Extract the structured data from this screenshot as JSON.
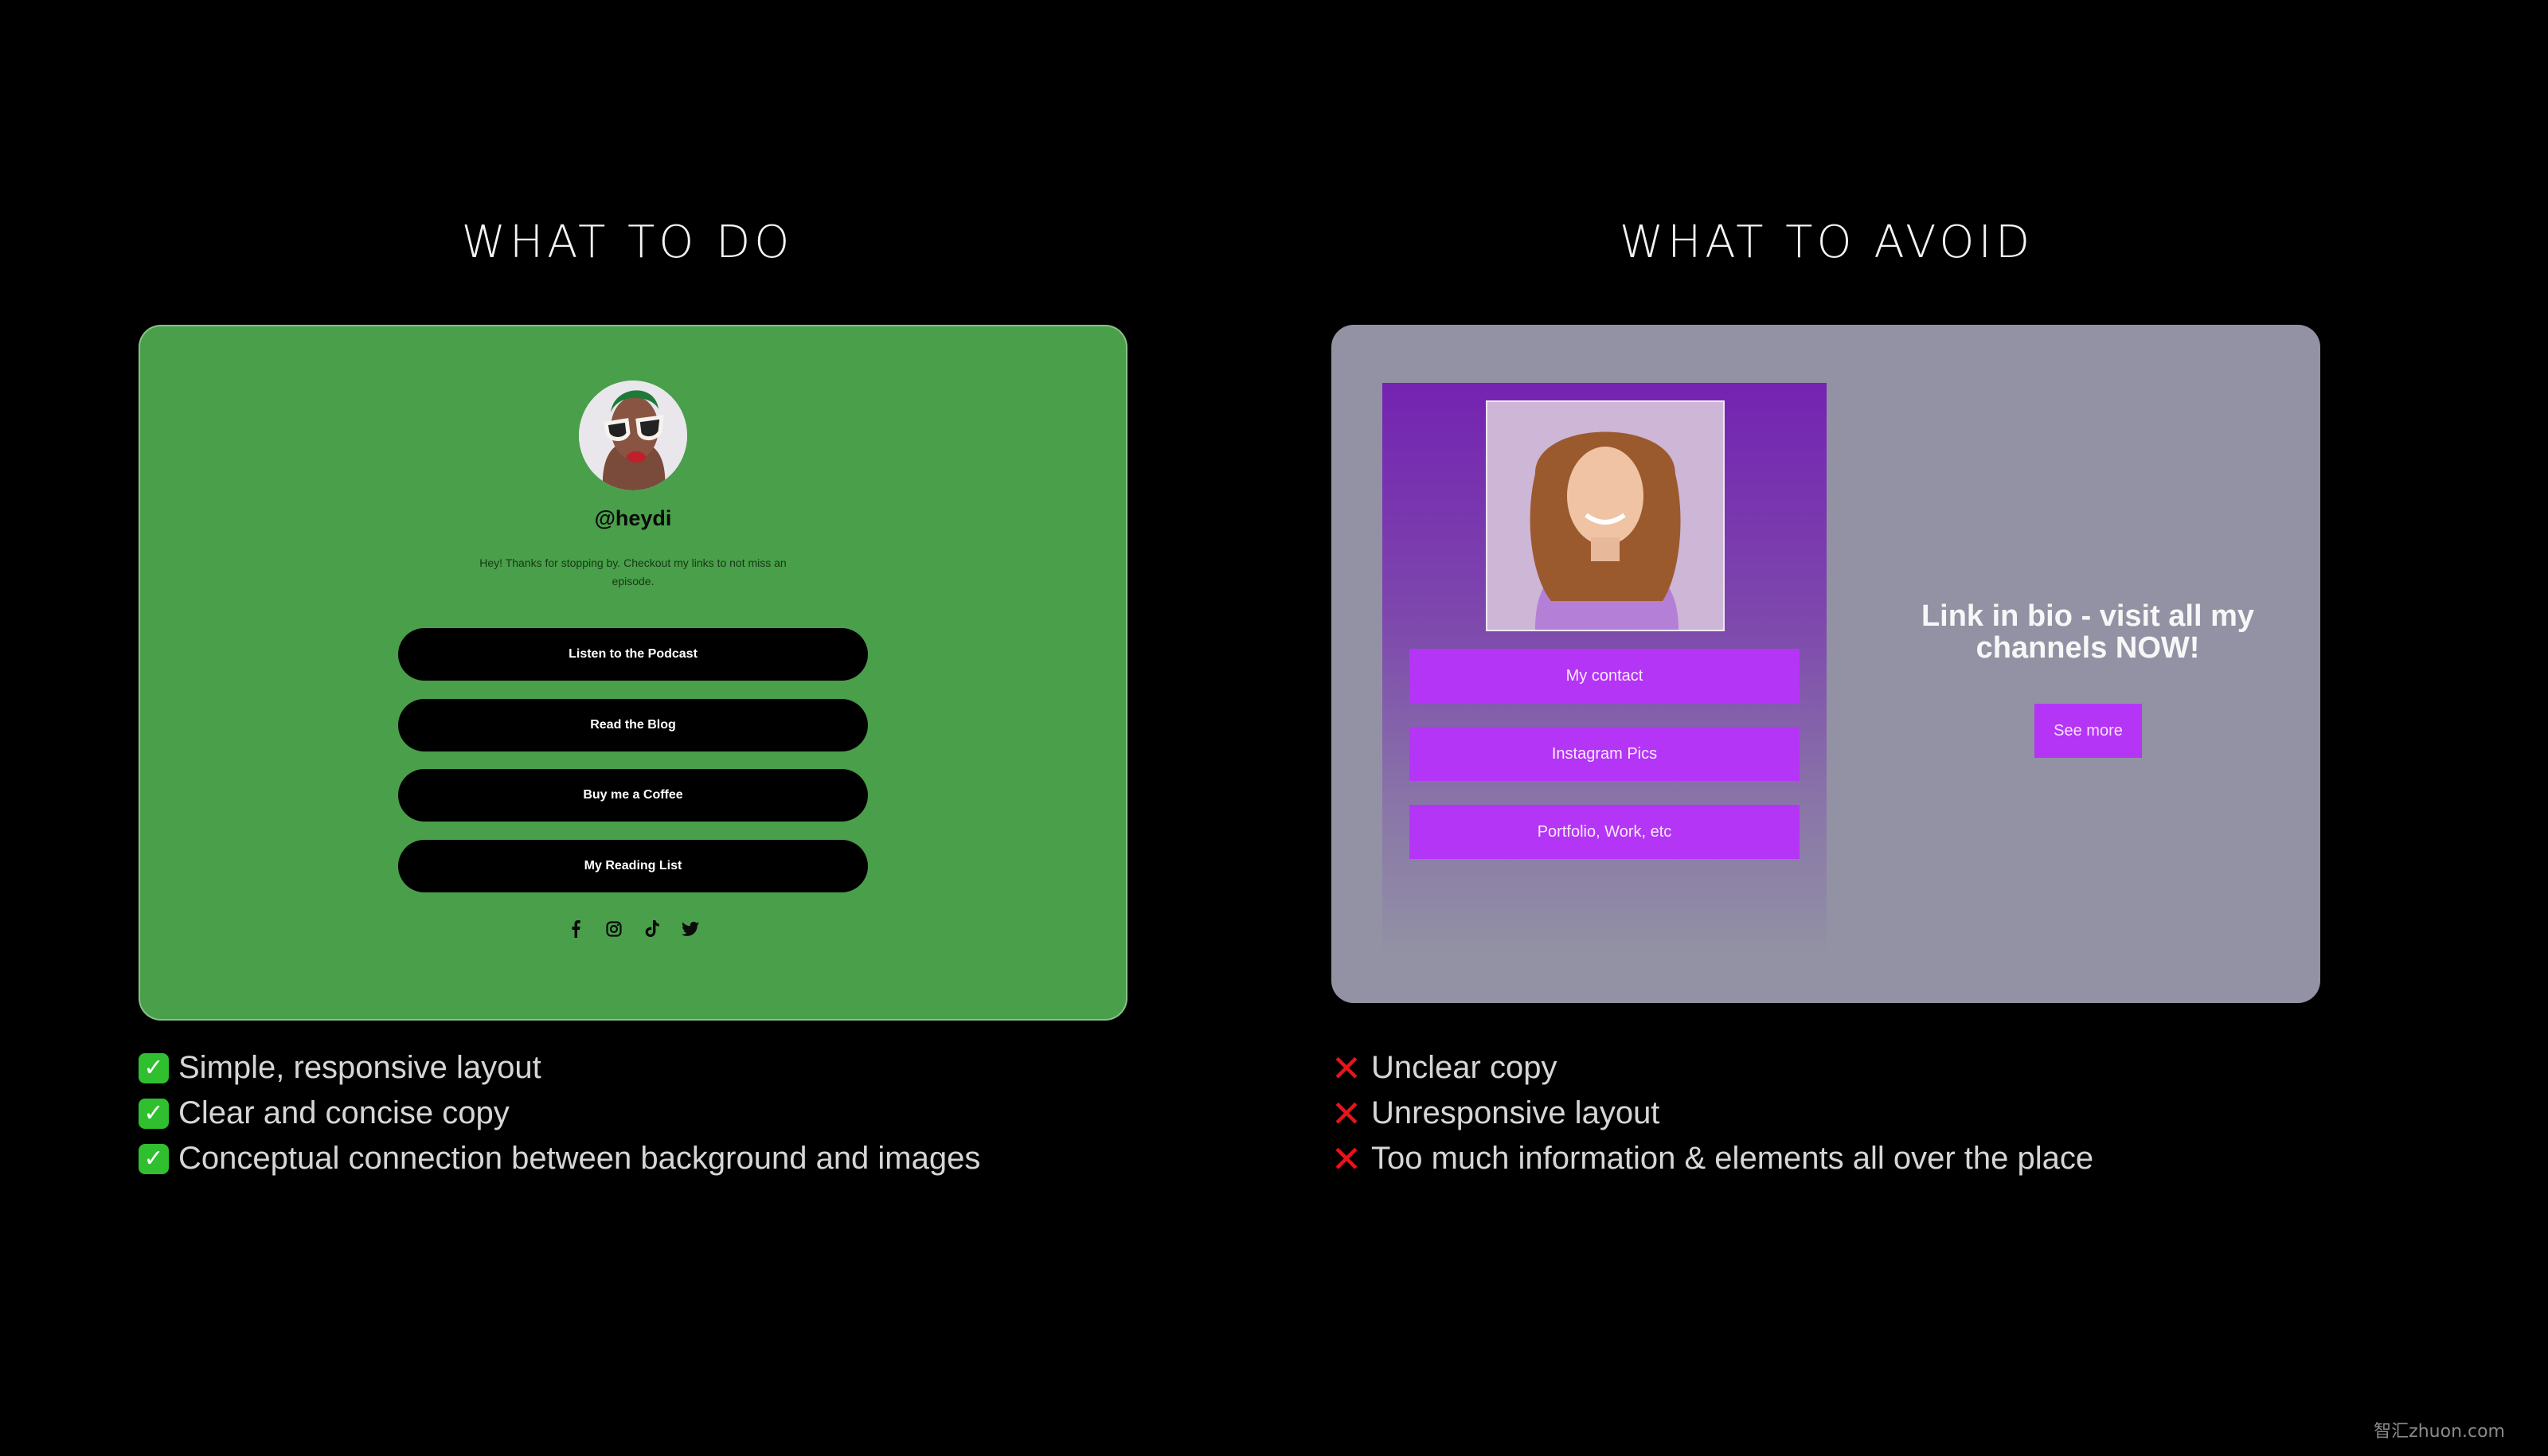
{
  "do_section": {
    "title": "WHAT TO DO",
    "card": {
      "background_color": "#4a9f4a",
      "handle": "@heydi",
      "bio": "Hey! Thanks for stopping by. Checkout my links to not miss an episode.",
      "links": [
        {
          "label": "Listen to the Podcast"
        },
        {
          "label": "Read the Blog"
        },
        {
          "label": "Buy me a Coffee"
        },
        {
          "label": "My Reading List"
        }
      ],
      "social_icons": [
        "facebook-icon",
        "instagram-icon",
        "tiktok-icon",
        "twitter-icon"
      ]
    },
    "bullets": [
      {
        "icon": "check-mark-icon",
        "text": "Simple, responsive layout"
      },
      {
        "icon": "check-mark-icon",
        "text": "Clear and concise copy"
      },
      {
        "icon": "check-mark-icon",
        "text": "Conceptual connection between background and images"
      }
    ]
  },
  "avoid_section": {
    "title": "WHAT TO AVOID",
    "card": {
      "background_color": "#9292a4",
      "accent_color": "#b435f5",
      "links": [
        {
          "label": "My contact"
        },
        {
          "label": "Instagram Pics"
        },
        {
          "label": "Portfolio, Work, etc"
        }
      ],
      "headline": "Link in bio - visit all my channels NOW!",
      "cta_label": "See more"
    },
    "bullets": [
      {
        "icon": "cross-mark-icon",
        "text": "Unclear copy"
      },
      {
        "icon": "cross-mark-icon",
        "text": "Unresponsive layout"
      },
      {
        "icon": "cross-mark-icon",
        "text": "Too much information & elements all over the place"
      }
    ]
  },
  "watermark": "智汇zhuon.com"
}
